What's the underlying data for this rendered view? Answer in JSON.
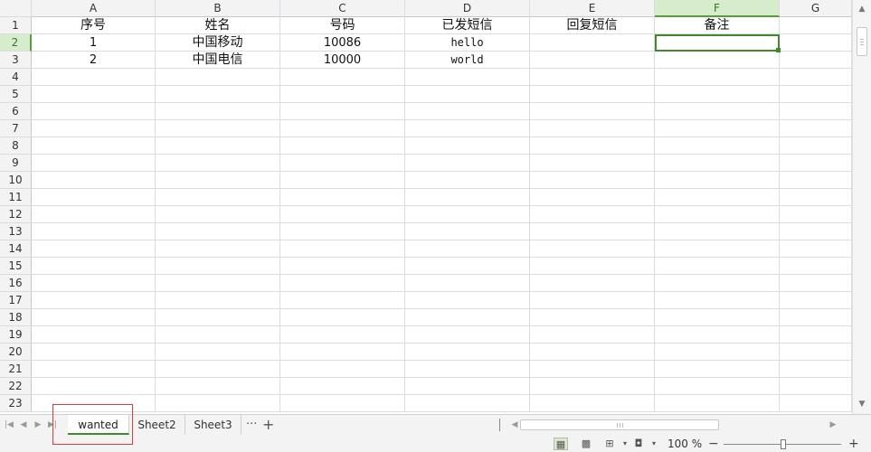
{
  "columns": [
    "A",
    "B",
    "C",
    "D",
    "E",
    "F",
    "G"
  ],
  "row_numbers": [
    "1",
    "2",
    "3",
    "4",
    "5",
    "6",
    "7",
    "8",
    "9",
    "10",
    "11",
    "12",
    "13",
    "14",
    "15",
    "16",
    "17",
    "18",
    "19",
    "20",
    "21",
    "22",
    "23"
  ],
  "cells": {
    "r1": [
      "序号",
      "姓名",
      "号码",
      "已发短信",
      "回复短信",
      "备注",
      ""
    ],
    "r2": [
      "1",
      "中国移动",
      "10086",
      "hello",
      "",
      "",
      ""
    ],
    "r3": [
      "2",
      "中国电信",
      "10000",
      "world",
      "",
      "",
      ""
    ]
  },
  "active_cell": "F2",
  "sheet_tabs": [
    "wanted",
    "Sheet2",
    "Sheet3"
  ],
  "tab_more": "···",
  "tab_add": "+",
  "zoom": {
    "label": "100 %",
    "minus": "−",
    "plus": "+",
    "level_percent": 100
  },
  "icons": {
    "first": "first-sheet-icon",
    "prev": "prev-sheet-icon",
    "next": "next-sheet-icon",
    "last": "last-sheet-icon"
  },
  "colors": {
    "accent": "#3f8a2a",
    "active_header_bg": "#d7ebcd",
    "highlight_box": "#e53935"
  }
}
